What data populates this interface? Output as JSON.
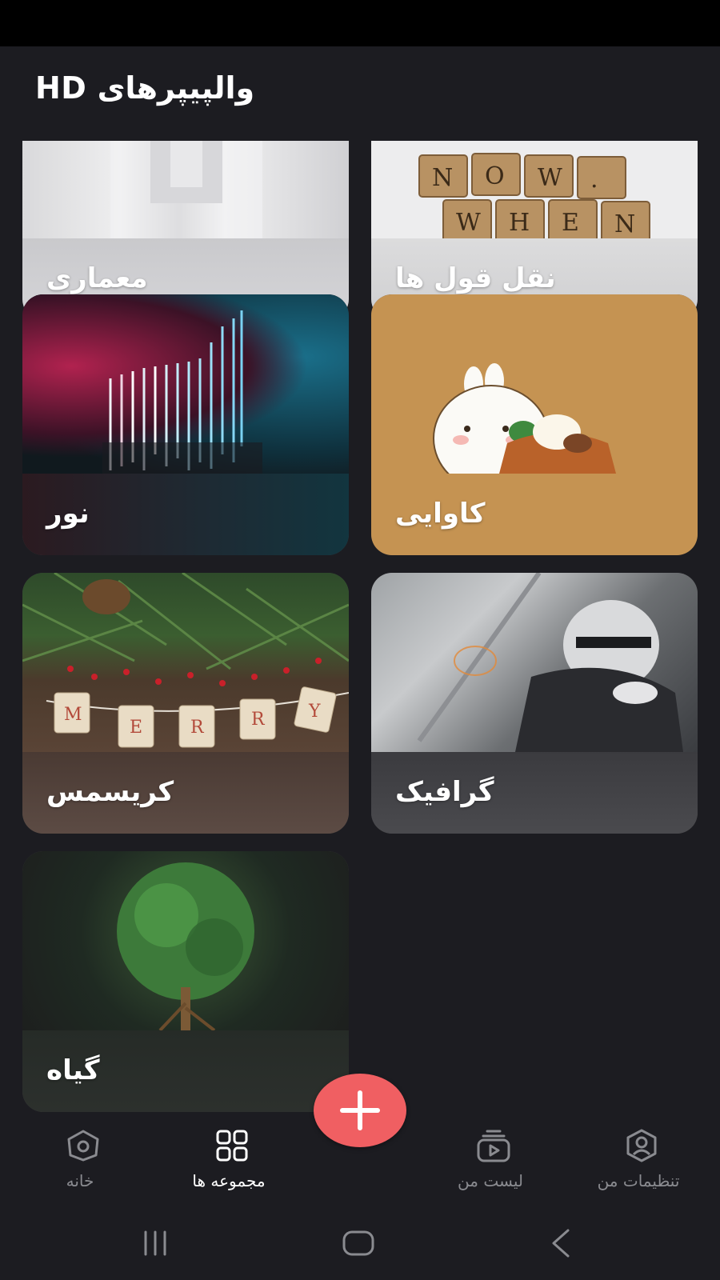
{
  "app": {
    "title": "والپیپرهای HD"
  },
  "categories": [
    {
      "label": "معماری"
    },
    {
      "label": "نقل قول ها"
    },
    {
      "label": "نور"
    },
    {
      "label": "کاوایی"
    },
    {
      "label": "کریسمس"
    },
    {
      "label": "گرافیک"
    },
    {
      "label": "گیاه"
    }
  ],
  "fab": {
    "icon": "plus-icon",
    "color": "#f05f62"
  },
  "bottom_nav": {
    "items": [
      {
        "label": "خانه",
        "icon": "home-icon",
        "active": false
      },
      {
        "label": "مجموعه ها",
        "icon": "grid-icon",
        "active": true
      },
      {
        "label": "لیست من",
        "icon": "playlist-icon",
        "active": false
      },
      {
        "label": "تنظیمات من",
        "icon": "profile-icon",
        "active": false
      }
    ]
  },
  "system_nav": {
    "buttons": [
      "recents-icon",
      "home-button-icon",
      "back-icon"
    ]
  },
  "colors": {
    "background": "#1c1c21",
    "status_bar": "#000000",
    "active_label": "#ffffff",
    "inactive_label": "#8a8b90",
    "accent": "#f05f62"
  }
}
